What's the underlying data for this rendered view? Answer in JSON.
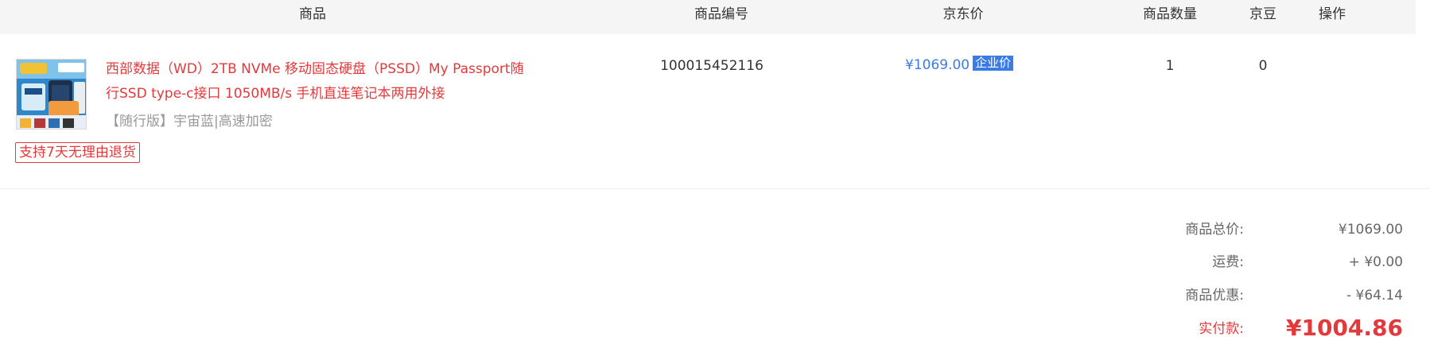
{
  "header": {
    "columns": {
      "product": "商品",
      "sku": "商品编号",
      "price": "京东价",
      "quantity": "商品数量",
      "beans": "京豆",
      "action": "操作"
    }
  },
  "item": {
    "name": "西部数据（WD）2TB NVMe 移动固态硬盘（PSSD）My Passport随行SSD type-c接口 1050MB/s 手机直连笔记本两用外接",
    "spec": "【随行版】宇宙蓝|高速加密",
    "return_policy": "支持7天无理由退货",
    "sku": "100015452116",
    "price": "¥1069.00",
    "price_badge": "企业价",
    "quantity": "1",
    "beans": "0",
    "thumbnail_icon": "ssd-product-image"
  },
  "summary": {
    "subtotal_label": "商品总价:",
    "subtotal_value": "¥1069.00",
    "shipping_label": "运费:",
    "shipping_value": "+ ¥0.00",
    "discount_label": "商品优惠:",
    "discount_value": "- ¥64.14",
    "total_label": "实付款:",
    "total_value": "¥1004.86"
  },
  "colors": {
    "accent_red": "#e4393c",
    "price_blue": "#3b7be6",
    "header_bg": "#f5f5f5"
  }
}
